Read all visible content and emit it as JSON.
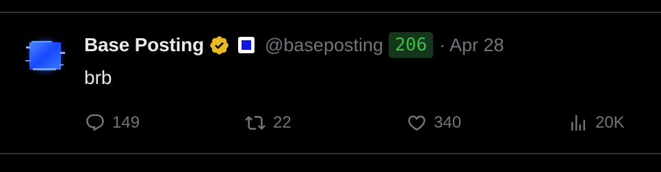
{
  "divider_color": "#2f3336",
  "post": {
    "author": {
      "display_name": "Base Posting",
      "handle": "@baseposting",
      "verified": true,
      "verified_badge_color": "#e8b829",
      "affiliate_badge_icon": "blue-square-icon",
      "avatar_icon": "glowing-blue-square-icon"
    },
    "count_badge": "206",
    "separator": "·",
    "date": "Apr 28",
    "text": "brb"
  },
  "actions": {
    "reply": {
      "icon": "reply-bubble-icon",
      "count": "149"
    },
    "repost": {
      "icon": "repost-icon",
      "count": "22"
    },
    "like": {
      "icon": "heart-icon",
      "count": "340"
    },
    "views": {
      "icon": "views-bar-icon",
      "count": "20K"
    }
  },
  "colors": {
    "background": "#000000",
    "text_primary": "#e7e9ea",
    "text_secondary": "#71767b",
    "badge_green_text": "#3fbf45",
    "badge_green_bg": "#14361b",
    "avatar_blue": "#1a5cff"
  }
}
